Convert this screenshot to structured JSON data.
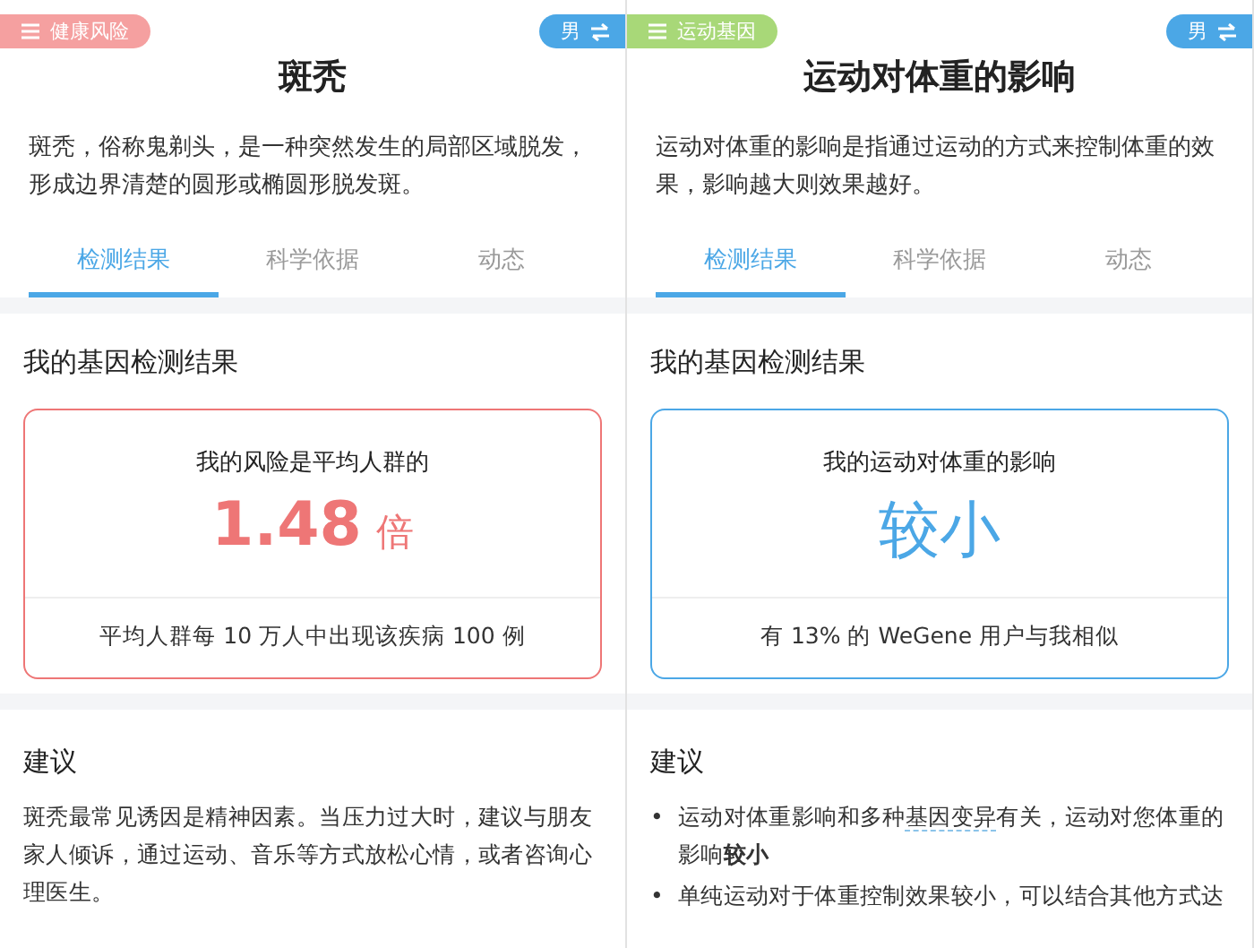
{
  "panels": [
    {
      "category": {
        "label": "健康风险",
        "color": "#f5a0a0"
      },
      "gender_toggle": "男",
      "title": "斑秃",
      "description": "斑秃，俗称鬼剃头，是一种突然发生的局部区域脱发，形成边界清楚的圆形或椭圆形脱发斑。",
      "tabs": [
        {
          "label": "检测结果",
          "selected": true
        },
        {
          "label": "科学依据",
          "selected": false
        },
        {
          "label": "动态",
          "selected": false
        }
      ],
      "result_heading": "我的基因检测结果",
      "result": {
        "kind": "risk",
        "color": "#ee7676",
        "caption": "我的风险是平均人群的",
        "value": "1.48",
        "unit": "倍",
        "footnote": "平均人群每 10 万人中出现该疾病 100 例"
      },
      "advice_heading": "建议",
      "advice": {
        "kind": "paragraph",
        "text": "斑秃最常见诱因是精神因素。当压力过大时，建议与朋友家人倾诉，通过运动、音乐等方式放松心情，或者咨询心理医生。"
      }
    },
    {
      "category": {
        "label": "运动基因",
        "color": "#a8d878"
      },
      "gender_toggle": "男",
      "title": "运动对体重的影响",
      "description": "运动对体重的影响是指通过运动的方式来控制体重的效果，影响越大则效果越好。",
      "tabs": [
        {
          "label": "检测结果",
          "selected": true
        },
        {
          "label": "科学依据",
          "selected": false
        },
        {
          "label": "动态",
          "selected": false
        }
      ],
      "result_heading": "我的基因检测结果",
      "result": {
        "kind": "level",
        "color": "#4ba7e6",
        "caption": "我的运动对体重的影响",
        "value": "较小",
        "footnote": "有 13% 的 WeGene 用户与我相似"
      },
      "advice_heading": "建议",
      "advice": {
        "kind": "bullets",
        "items": [
          {
            "marker": "•",
            "segments": [
              {
                "kind": "plain",
                "text": "运动对体重影响和多种"
              },
              {
                "kind": "term",
                "text": "基因变异"
              },
              {
                "kind": "plain",
                "text": "有关，运动对您体重的影响"
              },
              {
                "kind": "bold",
                "text": "较小"
              }
            ]
          },
          {
            "marker": "•",
            "segments": [
              {
                "kind": "plain",
                "text": "单纯运动对于体重控制效果较小，可以结合其他方式达"
              }
            ]
          }
        ]
      }
    }
  ]
}
